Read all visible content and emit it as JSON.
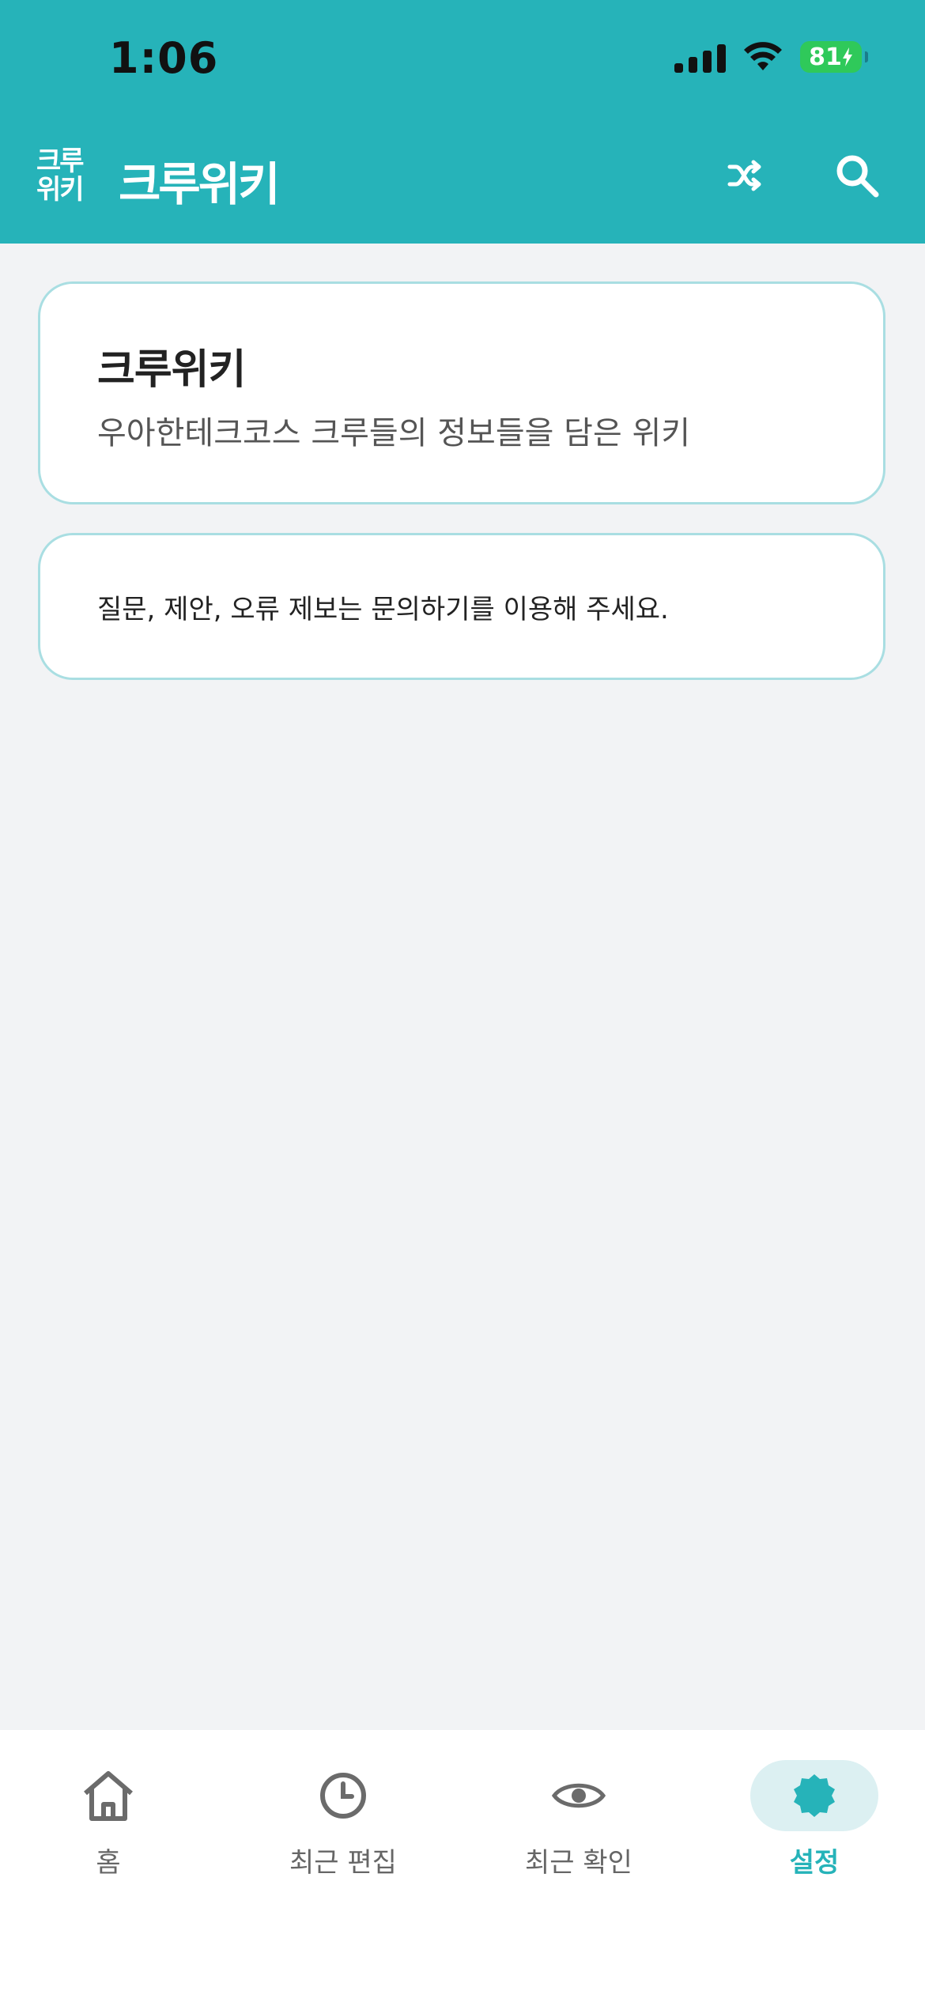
{
  "status_bar": {
    "time": "1:06",
    "battery": "81"
  },
  "header": {
    "logo_line1": "크루",
    "logo_line2": "위키",
    "title": "크루위키",
    "shuffle_icon": "shuffle-icon",
    "search_icon": "search-icon"
  },
  "intro_card": {
    "title": "크루위키",
    "description": "우아한테크코스 크루들의 정보들을 담은 위키"
  },
  "notice_card": {
    "text": "질문, 제안, 오류 제보는 문의하기를 이용해 주세요."
  },
  "bottom_nav": {
    "items": [
      {
        "label": "홈",
        "icon": "home-icon"
      },
      {
        "label": "최근 편집",
        "icon": "clock-icon"
      },
      {
        "label": "최근 확인",
        "icon": "eye-icon"
      },
      {
        "label": "설정",
        "icon": "settings-icon",
        "active": true
      }
    ]
  },
  "colors": {
    "accent": "#26b3b9",
    "background": "#f2f3f5",
    "card_border": "#a9dee2",
    "active_pill": "#dcf0f2"
  }
}
